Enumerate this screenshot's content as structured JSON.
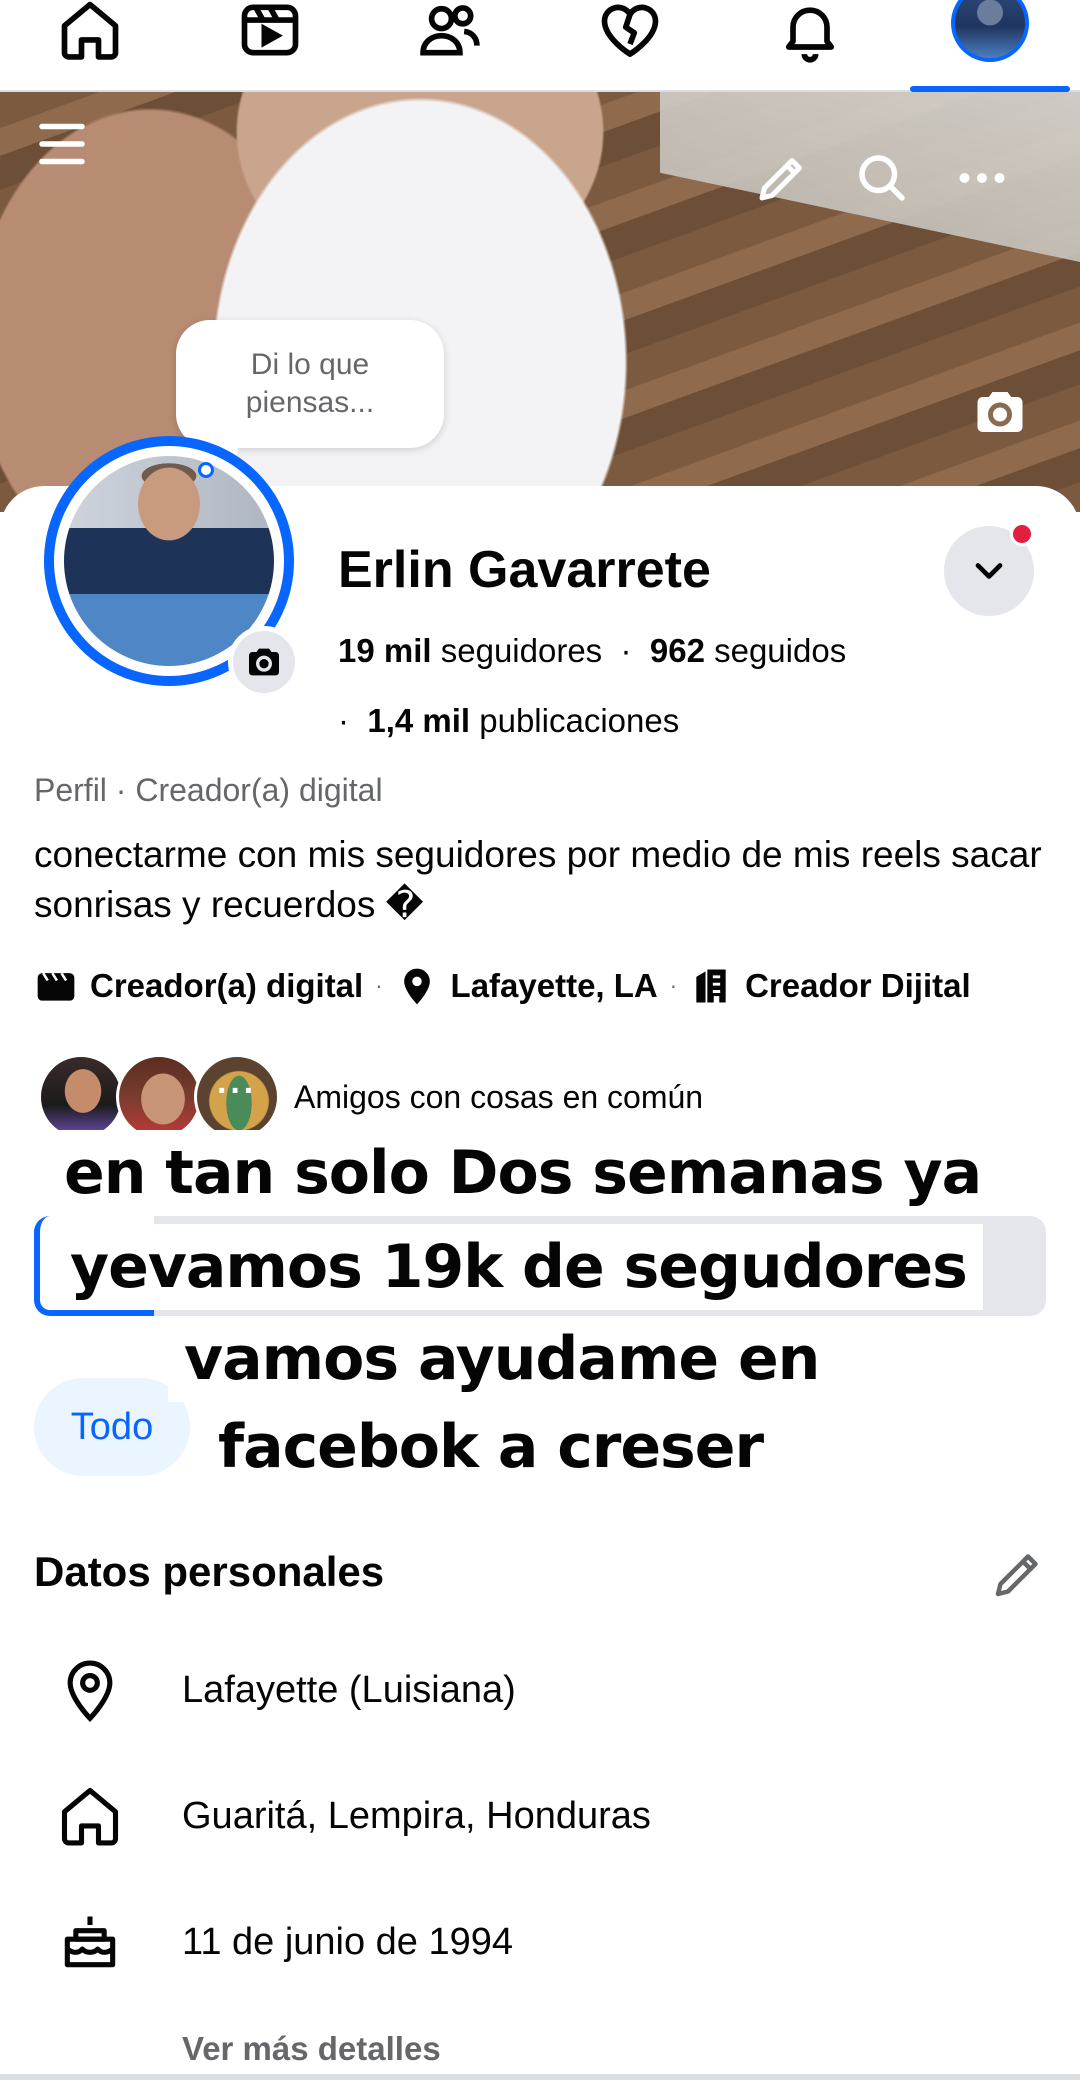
{
  "nav": {
    "tabs": [
      {
        "icon": "home-icon"
      },
      {
        "icon": "video-icon"
      },
      {
        "icon": "friends-icon"
      },
      {
        "icon": "dating-heart-icon"
      },
      {
        "icon": "bell-icon"
      },
      {
        "icon": "profile-avatar"
      }
    ],
    "active_tab": "profile",
    "accent": "#0866ff"
  },
  "cover": {
    "actions": [
      "menu-icon",
      "edit-pencil-icon",
      "search-icon",
      "more-icon",
      "camera-icon"
    ]
  },
  "bubble": {
    "line1": "Di lo que",
    "line2": "piensas..."
  },
  "profile": {
    "name": "Erlin Gavarrete",
    "followers_count": "19 mil",
    "followers_label": "seguidores",
    "following_count": "962",
    "following_label": "seguidos",
    "posts_count": "1,4 mil",
    "posts_label": "publicaciones",
    "category": "Perfil · Creador(a) digital",
    "bio": "conectarme con mis seguidores por medio de mis reels sacar sonrisas y recuerdos �",
    "detail_creator": "Creador(a) digital",
    "detail_location": "Lafayette, LA",
    "detail_work": "Creador Dijital",
    "friends_label": "Amigos con cosas en común",
    "friends_more": "···"
  },
  "overlay": {
    "line1": "en tan solo Dos semanas ya",
    "line2": "yevamos 19k de segudores",
    "line3": "vamos ayudame en",
    "line4": "facebok a creser"
  },
  "filter": {
    "chip": "Todo"
  },
  "personal": {
    "title": "Datos personales",
    "rows": [
      {
        "icon": "location-pin-icon",
        "text": "Lafayette (Luisiana)"
      },
      {
        "icon": "home-icon",
        "text": "Guaritá, Lempira, Honduras"
      },
      {
        "icon": "birthday-cake-icon",
        "text": "11 de junio de 1994"
      }
    ],
    "more": "Ver más detalles"
  }
}
